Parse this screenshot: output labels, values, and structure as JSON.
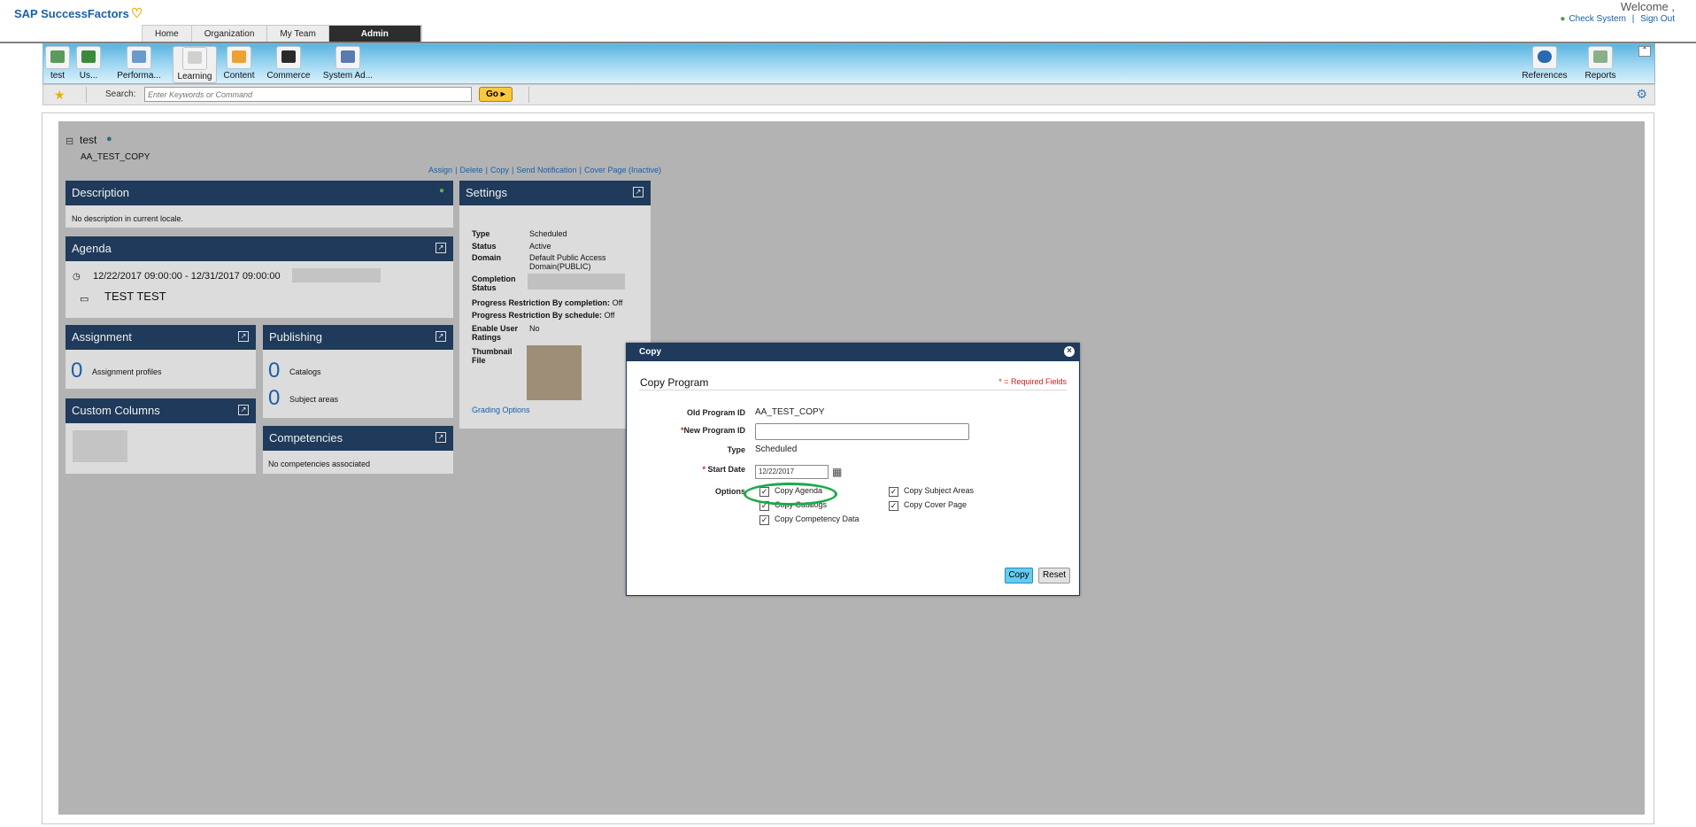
{
  "brand": "SAP SuccessFactors",
  "header": {
    "welcome": "Welcome ,",
    "check_system": "Check System",
    "divider": "|",
    "sign_out": "Sign Out"
  },
  "topnav": [
    "Home",
    "Organization",
    "My Team",
    "Admin"
  ],
  "toolbar": {
    "left": [
      "test",
      "Us...",
      "Performa...",
      "Learning",
      "Content",
      "Commerce",
      "System Ad..."
    ],
    "right": [
      "References",
      "Reports"
    ]
  },
  "search": {
    "label": "Search:",
    "placeholder": "Enter Keywords or Command",
    "go": "Go"
  },
  "program": {
    "title": "test",
    "id": "AA_TEST_COPY",
    "actions": [
      "Assign",
      "Delete",
      "Copy",
      "Send Notification",
      "Cover Page (Inactive)"
    ],
    "action_sep": "|"
  },
  "description": {
    "title": "Description",
    "text": "No description in current locale."
  },
  "agenda": {
    "title": "Agenda",
    "dates": "12/22/2017 09:00:00 - 12/31/2017 09:00:00",
    "item": "TEST TEST"
  },
  "assignment": {
    "title": "Assignment",
    "count": "0",
    "label": "Assignment profiles"
  },
  "publishing": {
    "title": "Publishing",
    "catalogs_count": "0",
    "catalogs_label": "Catalogs",
    "subjects_count": "0",
    "subjects_label": "Subject areas"
  },
  "custom_columns": {
    "title": "Custom Columns"
  },
  "competencies": {
    "title": "Competencies",
    "text": "No competencies associated"
  },
  "settings": {
    "title": "Settings",
    "type_label": "Type",
    "type_value": "Scheduled",
    "status_label": "Status",
    "status_value": "Active",
    "domain_label": "Domain",
    "domain_value": "Default Public Access Domain(PUBLIC)",
    "completion_label": "Completion Status",
    "prog_completion_label": "Progress Restriction By completion:",
    "prog_completion_value": "Off",
    "prog_schedule_label": "Progress Restriction By schedule:",
    "prog_schedule_value": "Off",
    "ratings_label": "Enable User Ratings",
    "ratings_value": "No",
    "thumbnail_label": "Thumbnail File",
    "grading": "Grading Options"
  },
  "modal": {
    "title": "Copy",
    "heading": "Copy Program",
    "required": "* = Required Fields",
    "old_id_label": "Old Program ID",
    "old_id_value": "AA_TEST_COPY",
    "new_id_label": "New Program ID",
    "type_label": "Type",
    "type_value": "Scheduled",
    "start_label": "Start Date",
    "start_value": "12/22/2017",
    "options_label": "Options",
    "options": {
      "agenda": "Copy Agenda",
      "catalogs": "Copy Catalogs",
      "competency": "Copy Competency Data",
      "subject_areas": "Copy Subject Areas",
      "cover_page": "Copy Cover Page"
    },
    "copy_button": "Copy",
    "reset_button": "Reset"
  },
  "colors": {
    "accent": "#1a5fa8",
    "panel_header": "#1f3a5a",
    "highlight": "#1aaa4a",
    "required": "#c82020"
  }
}
